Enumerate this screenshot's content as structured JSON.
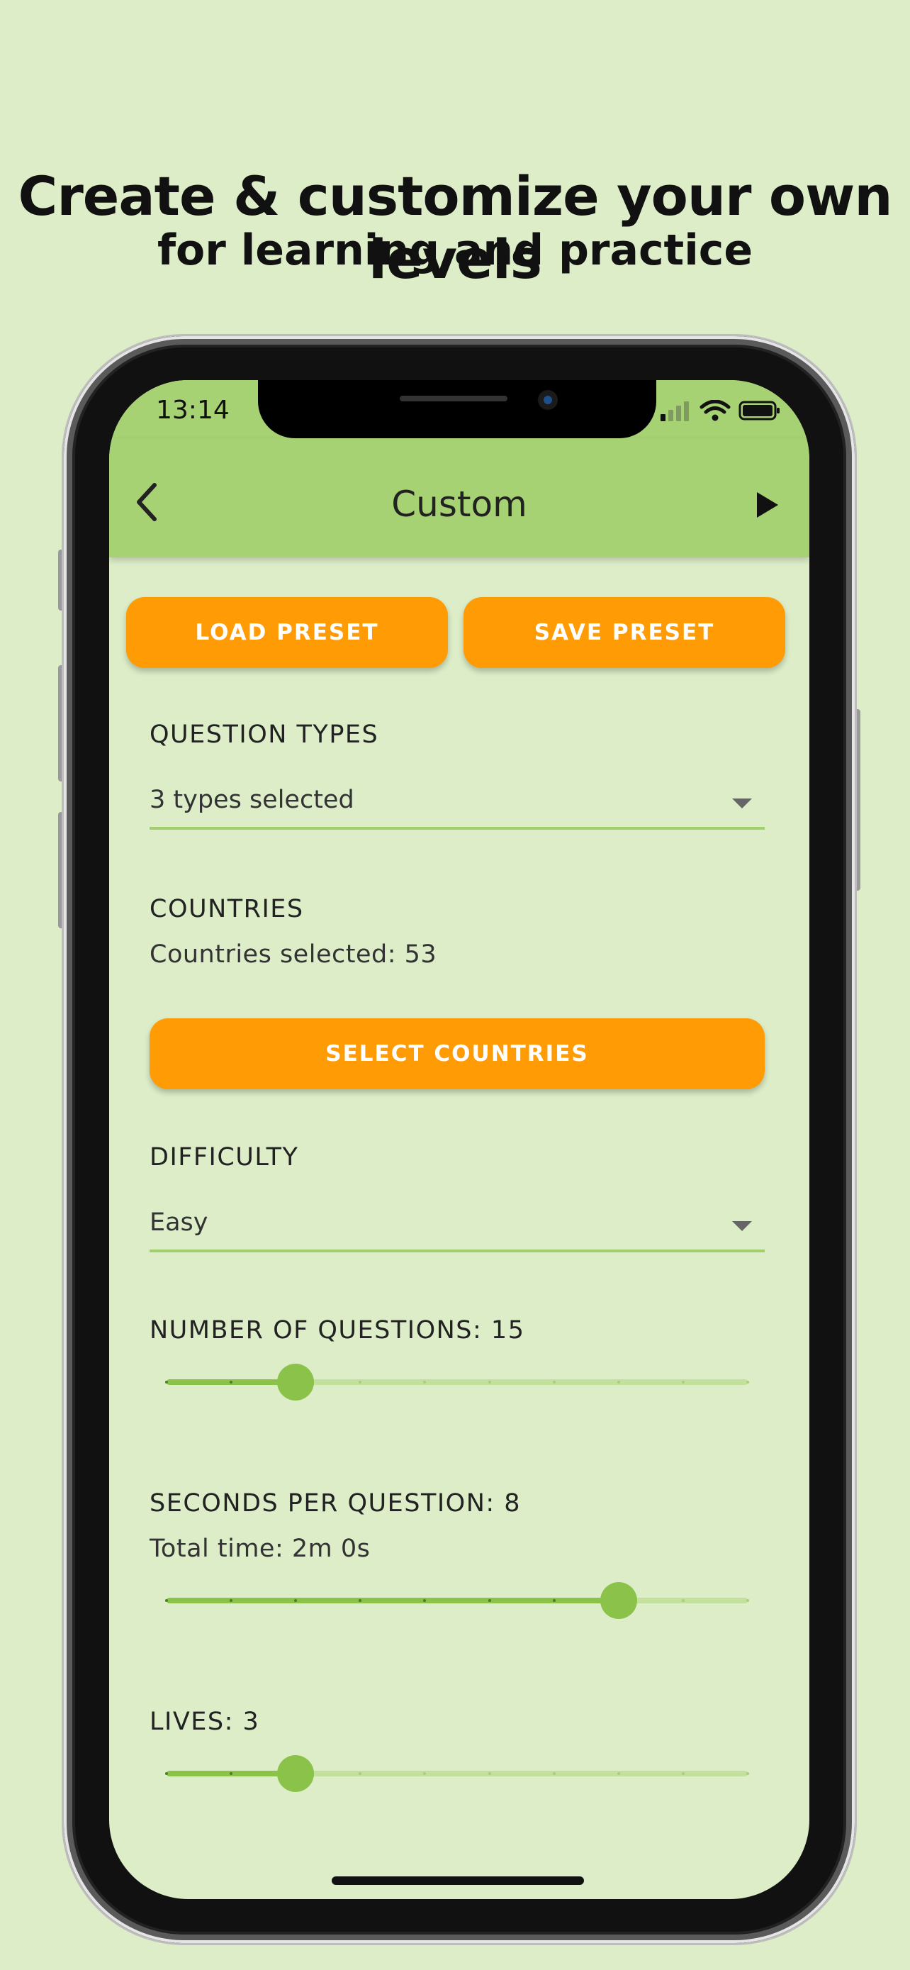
{
  "promo": {
    "title": "Create & customize your own levels",
    "subtitle": "for learning and practice"
  },
  "status_bar": {
    "time": "13:14",
    "icons": [
      "cellular-signal-icon",
      "wifi-icon",
      "battery-icon"
    ]
  },
  "app_bar": {
    "title": "Custom",
    "back_icon": "chevron-left-icon",
    "play_icon": "play-icon",
    "background": "#a7d274"
  },
  "presets": {
    "load_label": "LOAD PRESET",
    "save_label": "SAVE PRESET"
  },
  "question_types": {
    "label": "QUESTION TYPES",
    "value": "3 types selected"
  },
  "countries": {
    "label": "COUNTRIES",
    "summary": "Countries selected: 53",
    "button_label": "SELECT COUNTRIES"
  },
  "difficulty": {
    "label": "DIFFICULTY",
    "value": "Easy"
  },
  "number_of_questions": {
    "label": "NUMBER OF QUESTIONS: 15",
    "slider_steps": 10,
    "slider_index": 2
  },
  "seconds_per_question": {
    "label": "SECONDS PER QUESTION: 8",
    "total_time": "Total time: 2m 0s",
    "slider_steps": 10,
    "slider_index": 7
  },
  "lives": {
    "label": "LIVES: 3",
    "slider_steps": 10,
    "slider_index": 2
  },
  "colors": {
    "accent_orange": "#ff9b05",
    "slider_green": "#8bc34a",
    "background": "#dcedc8"
  }
}
